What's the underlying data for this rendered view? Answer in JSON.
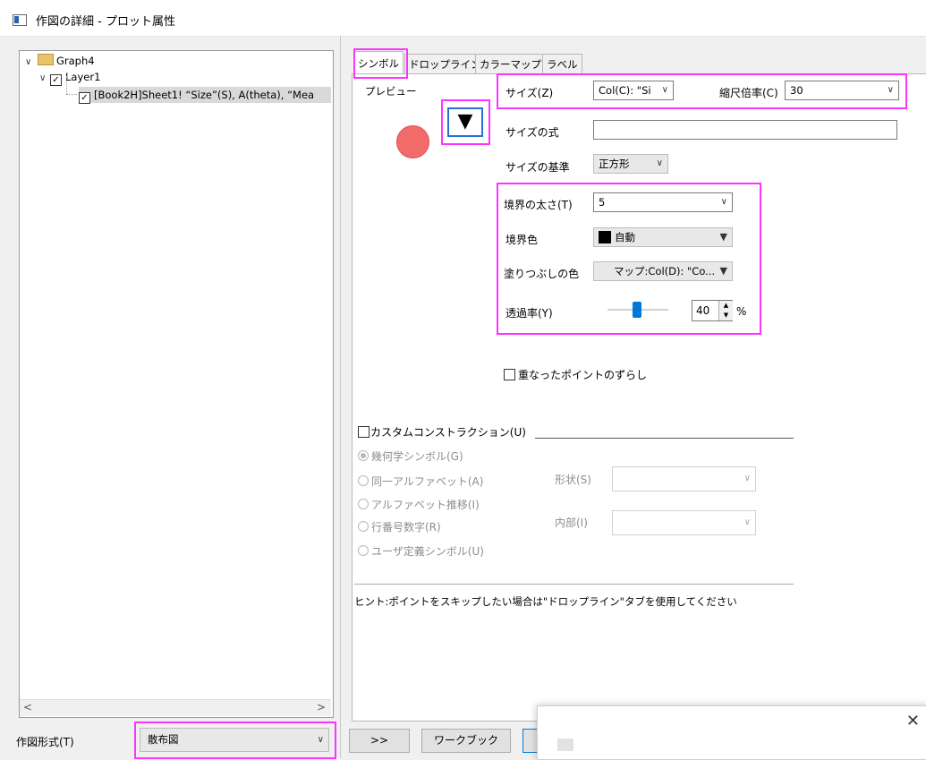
{
  "window": {
    "title": "作図の詳細 - プロット属性"
  },
  "tree": {
    "graph": "Graph4",
    "layer": "Layer1",
    "plot": "[Book2H]Sheet1! “Size”(S), A(theta), “Mea"
  },
  "tabs": [
    "シンボル",
    "ドロップライン",
    "カラーマップ",
    "ラベル"
  ],
  "preview": {
    "label": "プレビュー",
    "symbol_color": "#f26a6a",
    "button_glyph": "▼"
  },
  "size": {
    "label": "サイズ(Z)",
    "value": "Col(C): \"Si",
    "scale_label": "縮尺倍率(C)",
    "scale_value": "30"
  },
  "size_formula": {
    "label": "サイズの式",
    "value": ""
  },
  "size_basis": {
    "label": "サイズの基準",
    "value": "正方形"
  },
  "edge_thickness": {
    "label": "境界の太さ(T)",
    "value": "5"
  },
  "edge_color": {
    "label": "境界色",
    "value": "自動",
    "swatch": "#000000"
  },
  "fill_color": {
    "label": "塗りつぶしの色",
    "value": "マップ:Col(D): \"Co..."
  },
  "transparency": {
    "label": "透過率(Y)",
    "value": "40",
    "unit": "%",
    "fraction": 0.4
  },
  "offset_overlap": {
    "label": "重なったポイントのずらし",
    "checked": false
  },
  "custom": {
    "label": "カスタムコンストラクション(U)",
    "options": [
      "幾何学シンボル(G)",
      "同一アルファベット(A)",
      "アルファベット推移(I)",
      "行番号数字(R)",
      "ユーザ定義シンボル(U)"
    ],
    "shape_label": "形状(S)",
    "interior_label": "内部(I)"
  },
  "hint": "ヒント:ポイントをスキップしたい場合は\"ドロップライン\"タブを使用してください",
  "bottom": {
    "plot_type_label": "作図形式(T)",
    "plot_type_value": "散布図",
    "expand_button": ">>",
    "workbook_button": "ワークブック"
  },
  "popup": {
    "close_glyph": "✕"
  },
  "highlight_color": "#ff33ff"
}
